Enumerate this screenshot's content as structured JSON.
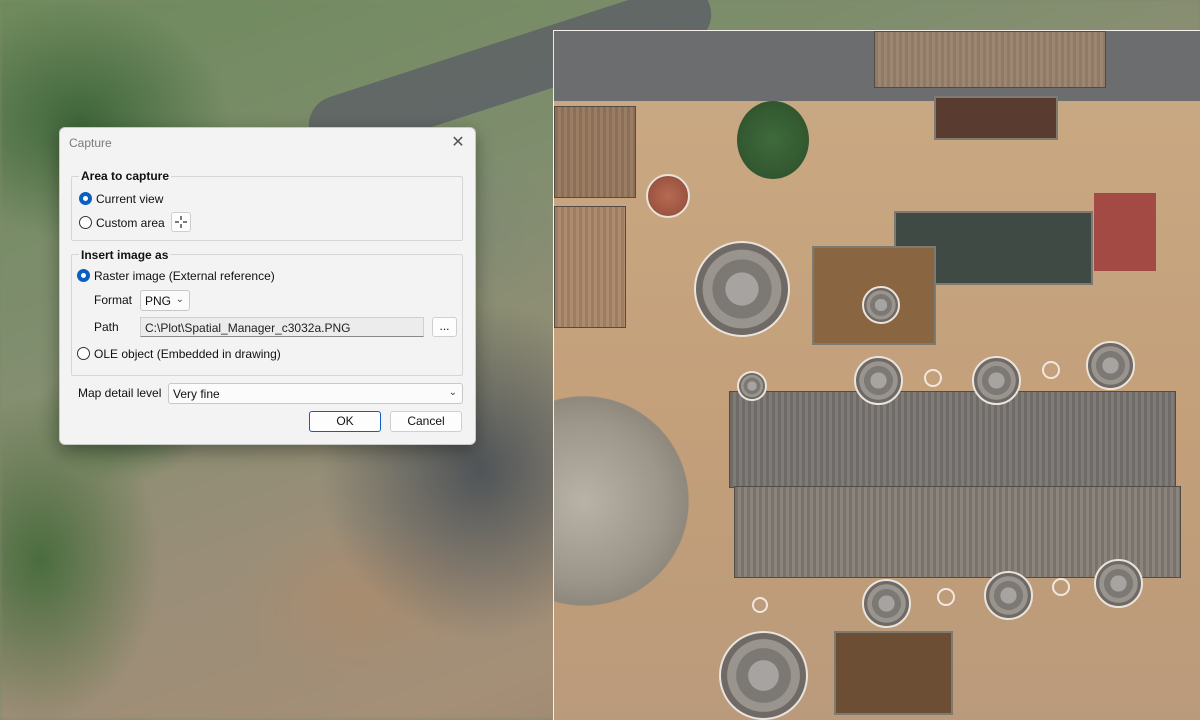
{
  "dialog": {
    "title": "Capture",
    "close_glyph": "✕",
    "area_group": {
      "title": "Area to capture",
      "current_view": "Current view",
      "custom_area": "Custom area",
      "pick_icon": "crosshair-icon",
      "selected": "current_view"
    },
    "insert_group": {
      "title": "Insert image as",
      "raster": "Raster image (External reference)",
      "format_label": "Format",
      "format_value": "PNG",
      "path_label": "Path",
      "path_value": "C:\\Plot\\Spatial_Manager_c3032a.PNG",
      "browse_label": "...",
      "ole": "OLE object (Embedded in drawing)",
      "selected": "raster"
    },
    "detail_label": "Map detail level",
    "detail_value": "Very fine",
    "ok_label": "OK",
    "cancel_label": "Cancel"
  },
  "colors": {
    "accent": "#0a5fc2",
    "dialog_bg": "#f3f3f3"
  }
}
